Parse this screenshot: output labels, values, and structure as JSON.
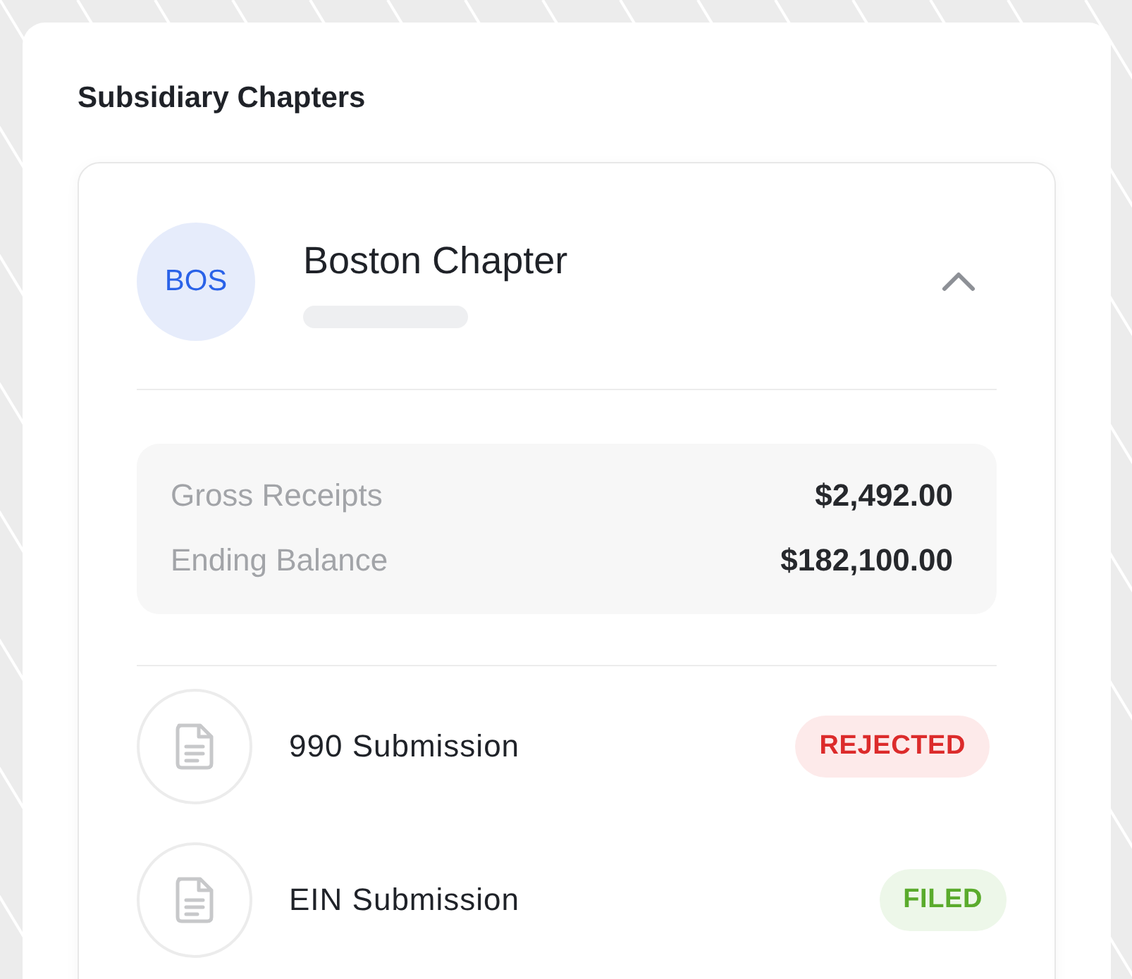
{
  "section_title": "Subsidiary Chapters",
  "chapter": {
    "initials": "BOS",
    "name": "Boston Chapter",
    "expanded": true,
    "summary": [
      {
        "label": "Gross Receipts",
        "value": "$2,492.00"
      },
      {
        "label": "Ending Balance",
        "value": "$182,100.00"
      }
    ],
    "submissions": [
      {
        "name": "990 Submission",
        "status": "REJECTED",
        "kind": "rejected"
      },
      {
        "name": "EIN Submission",
        "status": "FILED",
        "kind": "filed"
      }
    ]
  }
}
